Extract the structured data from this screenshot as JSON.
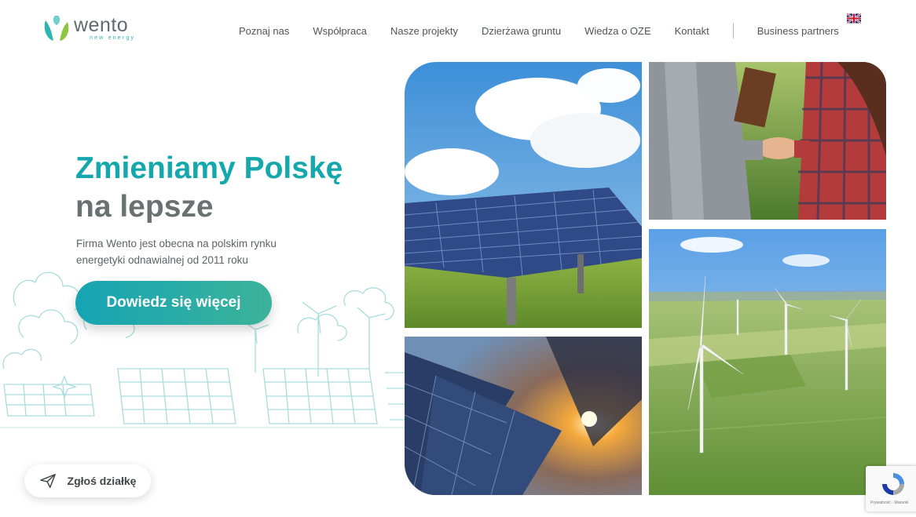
{
  "brand": {
    "name": "wento",
    "tagline": "new energy"
  },
  "nav": {
    "items": [
      "Poznaj nas",
      "Współpraca",
      "Nasze projekty",
      "Dzierżawa gruntu",
      "Wiedza o OZE",
      "Kontakt"
    ],
    "partners": "Business partners",
    "language_icon": "uk-flag-icon"
  },
  "hero": {
    "title_line1": "Zmieniamy Polskę",
    "title_line2": "na lepsze",
    "subtitle": "Firma Wento jest obecna na polskim rynku energetyki odnawialnej od 2011 roku",
    "cta_label": "Dowiedz się więcej"
  },
  "report_button": {
    "label": "Zgłoś działkę",
    "icon": "paper-plane-icon"
  },
  "recaptcha": {
    "text": "Prywatność - Warunki"
  },
  "colors": {
    "accent": "#14a8ad",
    "accent_green": "#3cb39a",
    "title_gray": "#6a7173"
  }
}
